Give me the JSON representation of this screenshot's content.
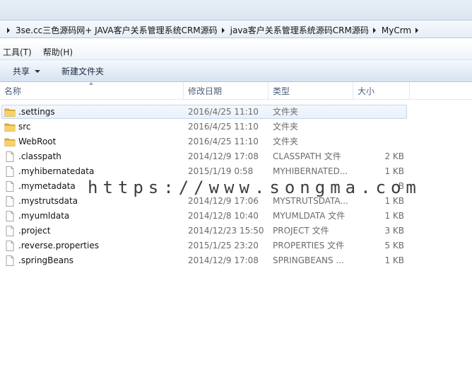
{
  "breadcrumb": [
    "3se.cc三色源码网+ JAVA客户关系管理系统CRM源码",
    "java客户关系管理系统源码CRM源码",
    "MyCrm"
  ],
  "menu": {
    "tools": "工具(T)",
    "help": "帮助(H)"
  },
  "toolbar": {
    "share": "共享",
    "new_folder": "新建文件夹"
  },
  "columns": {
    "name": "名称",
    "modified": "修改日期",
    "type": "类型",
    "size": "大小"
  },
  "files": [
    {
      "name": ".settings",
      "modified": "2016/4/25 11:10",
      "type": "文件夹",
      "size": "",
      "icon": "folder-icon"
    },
    {
      "name": "src",
      "modified": "2016/4/25 11:10",
      "type": "文件夹",
      "size": "",
      "icon": "folder-icon"
    },
    {
      "name": "WebRoot",
      "modified": "2016/4/25 11:10",
      "type": "文件夹",
      "size": "",
      "icon": "folder-icon"
    },
    {
      "name": ".classpath",
      "modified": "2014/12/9 17:08",
      "type": "CLASSPATH 文件",
      "size": "2 KB",
      "icon": "file-icon"
    },
    {
      "name": ".myhibernatedata",
      "modified": "2015/1/19 0:58",
      "type": "MYHIBERNATED...",
      "size": "1 KB",
      "icon": "file-icon"
    },
    {
      "name": ".mymetadata",
      "modified": "",
      "type": "",
      "size": "B",
      "icon": "file-icon"
    },
    {
      "name": ".mystrutsdata",
      "modified": "2014/12/9 17:06",
      "type": "MYSTRUTSDATA...",
      "size": "1 KB",
      "icon": "file-icon"
    },
    {
      "name": ".myumldata",
      "modified": "2014/12/8 10:40",
      "type": "MYUMLDATA 文件",
      "size": "1 KB",
      "icon": "file-icon"
    },
    {
      "name": ".project",
      "modified": "2014/12/23 15:50",
      "type": "PROJECT 文件",
      "size": "3 KB",
      "icon": "file-icon"
    },
    {
      "name": ".reverse.properties",
      "modified": "2015/1/25 23:20",
      "type": "PROPERTIES 文件",
      "size": "5 KB",
      "icon": "file-icon"
    },
    {
      "name": ".springBeans",
      "modified": "2014/12/9 17:08",
      "type": "SPRINGBEANS ...",
      "size": "1 KB",
      "icon": "file-icon"
    }
  ],
  "watermark": "https://www.songma.com"
}
